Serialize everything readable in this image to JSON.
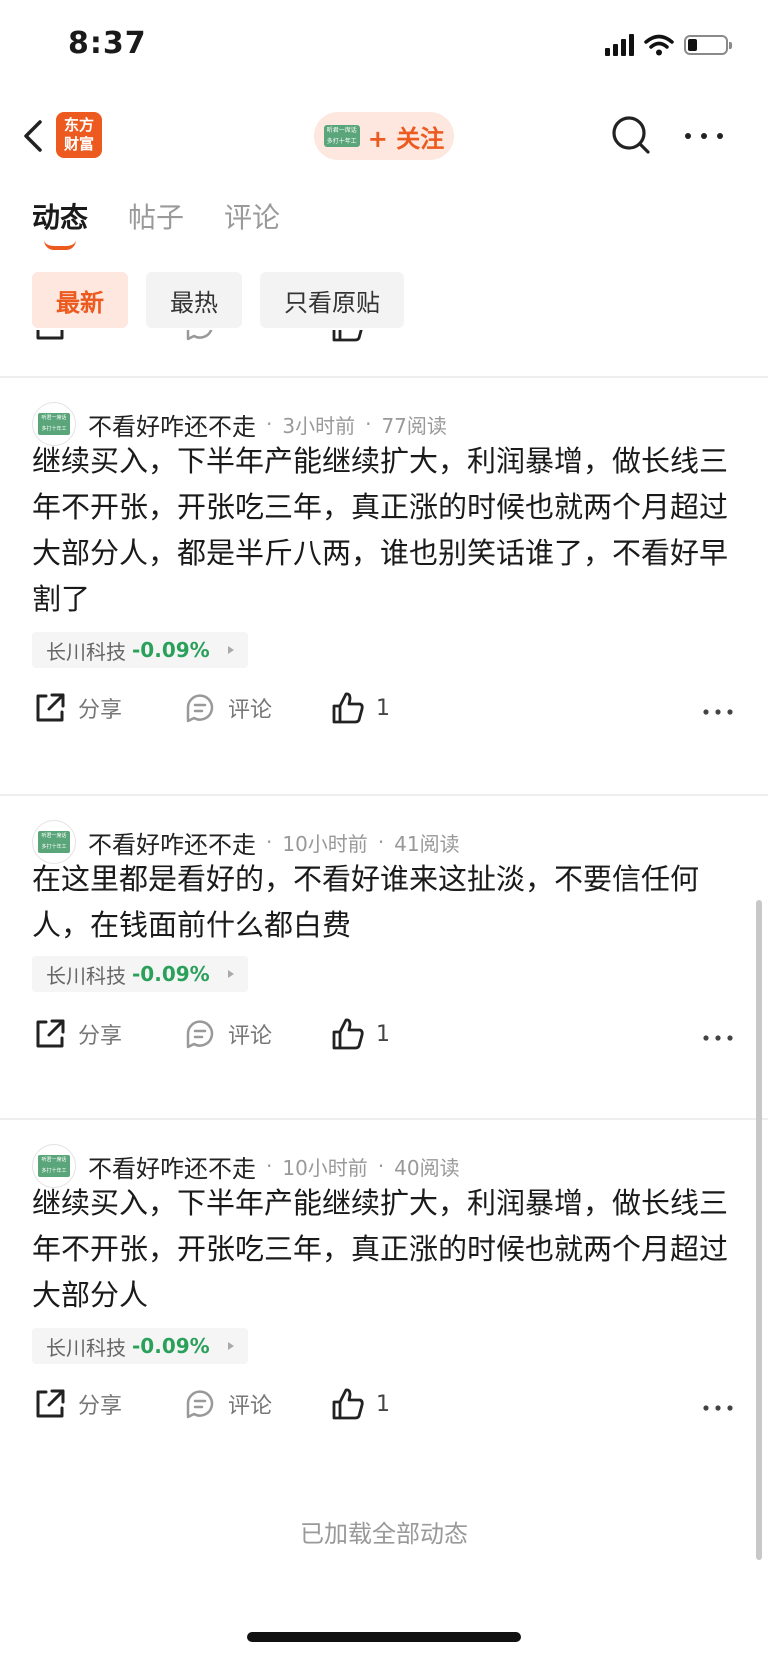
{
  "status_bar": {
    "time": "8:37"
  },
  "header": {
    "logo_line1": "东方",
    "logo_line2": "财富",
    "follow_label": "+ 关注",
    "avatar_line1": "听君一席话",
    "avatar_line2": "多打十年工"
  },
  "tabs": [
    {
      "label": "动态",
      "active": true
    },
    {
      "label": "帖子",
      "active": false
    },
    {
      "label": "评论",
      "active": false
    }
  ],
  "filters": [
    {
      "label": "最新",
      "active": true
    },
    {
      "label": "最热",
      "active": false
    },
    {
      "label": "只看原贴",
      "active": false
    }
  ],
  "posts": [
    {
      "avatar_line1": "听君一席话",
      "avatar_line2": "多打十年工",
      "author": "不看好咋还不走",
      "time": "3小时前",
      "reads": "77阅读",
      "text": "继续买入，下半年产能继续扩大，利润暴增，做长线三年不开张，开张吃三年，真正涨的时候也就两个月超过大部分人，都是半斤八两，谁也别笑话谁了，不看好早割了",
      "stock": {
        "name": "长川科技",
        "change": "-0.09%"
      },
      "actions": {
        "share": "分享",
        "comment": "评论",
        "likes": "1"
      }
    },
    {
      "avatar_line1": "听君一席话",
      "avatar_line2": "多打十年工",
      "author": "不看好咋还不走",
      "time": "10小时前",
      "reads": "41阅读",
      "text": "在这里都是看好的，不看好谁来这扯淡，不要信任何人，在钱面前什么都白费",
      "stock": {
        "name": "长川科技",
        "change": "-0.09%"
      },
      "actions": {
        "share": "分享",
        "comment": "评论",
        "likes": "1"
      }
    },
    {
      "avatar_line1": "听君一席话",
      "avatar_line2": "多打十年工",
      "author": "不看好咋还不走",
      "time": "10小时前",
      "reads": "40阅读",
      "text": "继续买入，下半年产能继续扩大，利润暴增，做长线三年不开张，开张吃三年，真正涨的时候也就两个月超过大部分人",
      "stock": {
        "name": "长川科技",
        "change": "-0.09%"
      },
      "actions": {
        "share": "分享",
        "comment": "评论",
        "likes": "1"
      }
    }
  ],
  "footer": {
    "loaded_all": "已加载全部动态"
  },
  "colors": {
    "accent": "#ec5a1f",
    "stock_up_down": "#2aa05a",
    "muted": "#999999"
  }
}
